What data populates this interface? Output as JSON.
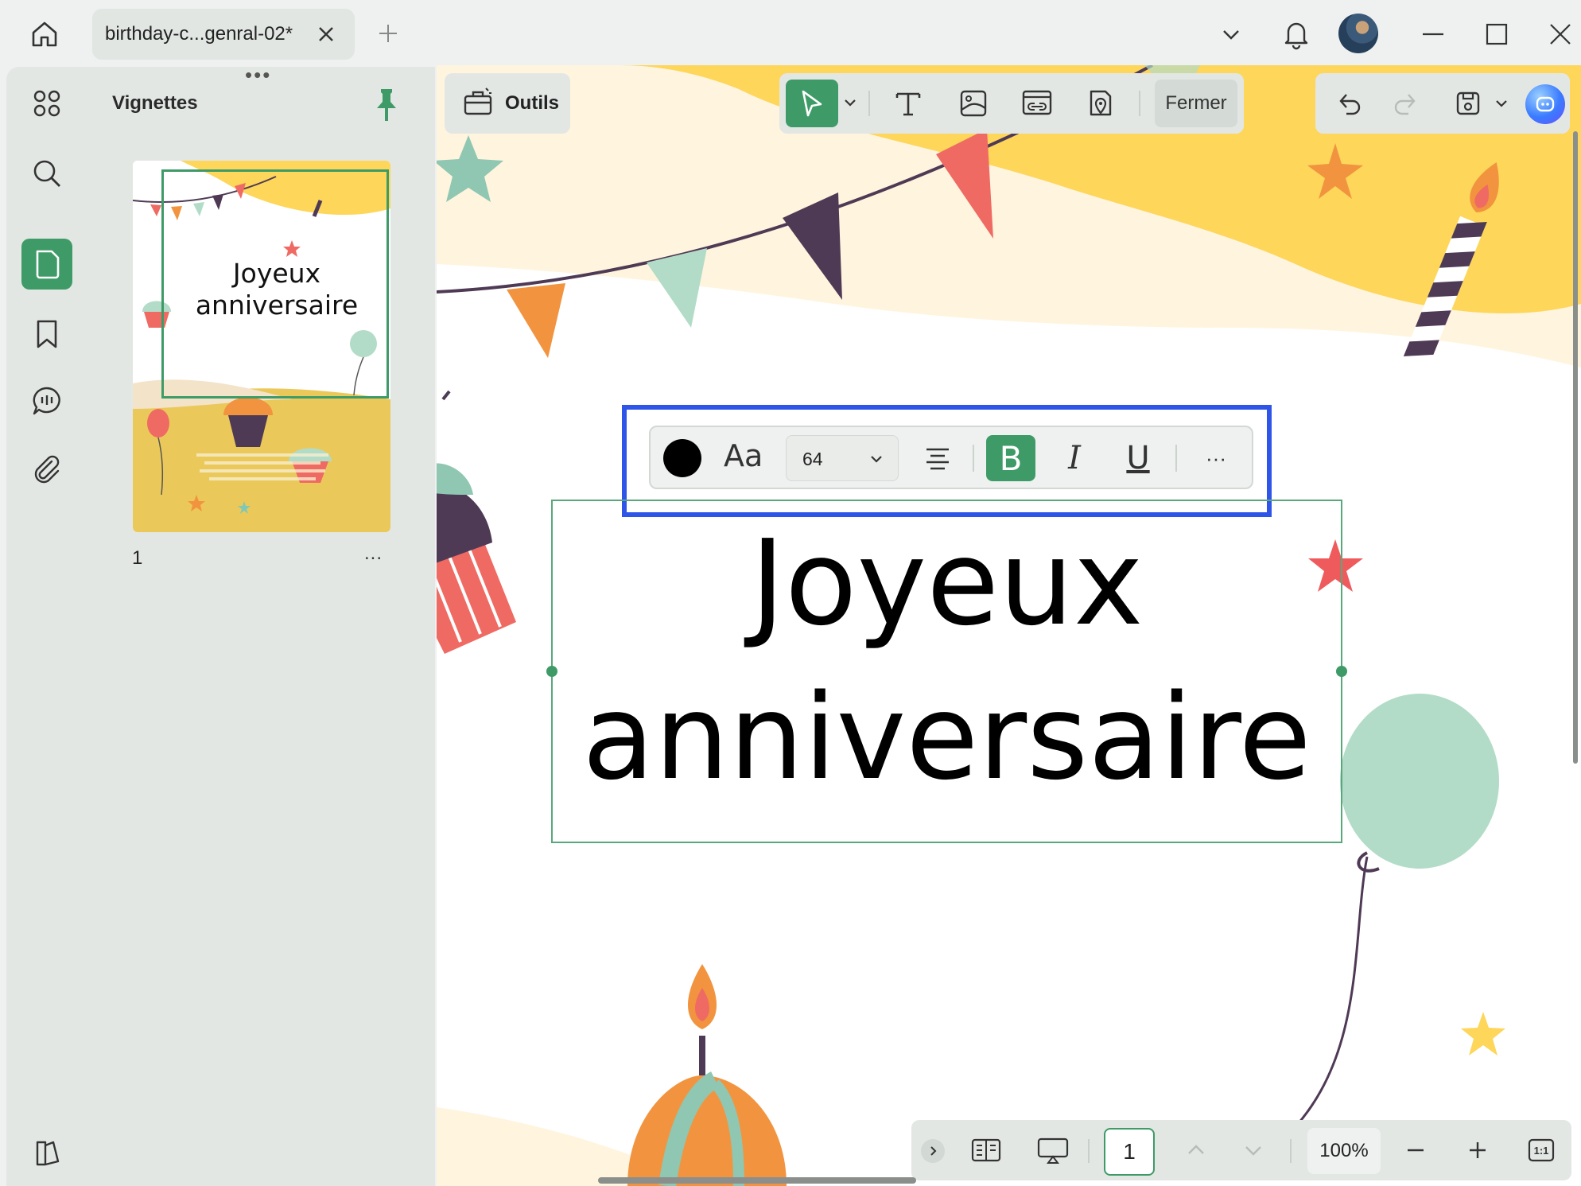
{
  "window": {
    "tab_title": "birthday-c...genral-02*"
  },
  "icons": {
    "home": "home-icon",
    "close": "close-icon",
    "add": "plus-icon",
    "chevron": "chevron-down-icon",
    "bell": "bell-icon"
  },
  "sidebar": {
    "panel_title": "Vignettes",
    "page_number": "1",
    "more": "...",
    "thumbnail_title_line1": "Joyeux",
    "thumbnail_title_line2": "anniversaire"
  },
  "toolbar": {
    "outils_label": "Outils",
    "fermer_label": "Fermer"
  },
  "format_bar": {
    "font_button": "Aa",
    "font_size": "64",
    "bold": "B",
    "italic": "I",
    "underline": "U",
    "more": "···"
  },
  "document": {
    "title_line1": "Joyeux",
    "title_line2": "anniversaire"
  },
  "bottom_bar": {
    "page_input": "1",
    "zoom": "100%",
    "fit_label": "1:1"
  },
  "colors": {
    "accent": "#3e9b67",
    "highlight": "#2e55e8",
    "yellow": "#fdd65a",
    "mint": "#b2dcc8",
    "orange": "#f2943f",
    "coral": "#ef6a63",
    "plum": "#4f3a55"
  }
}
